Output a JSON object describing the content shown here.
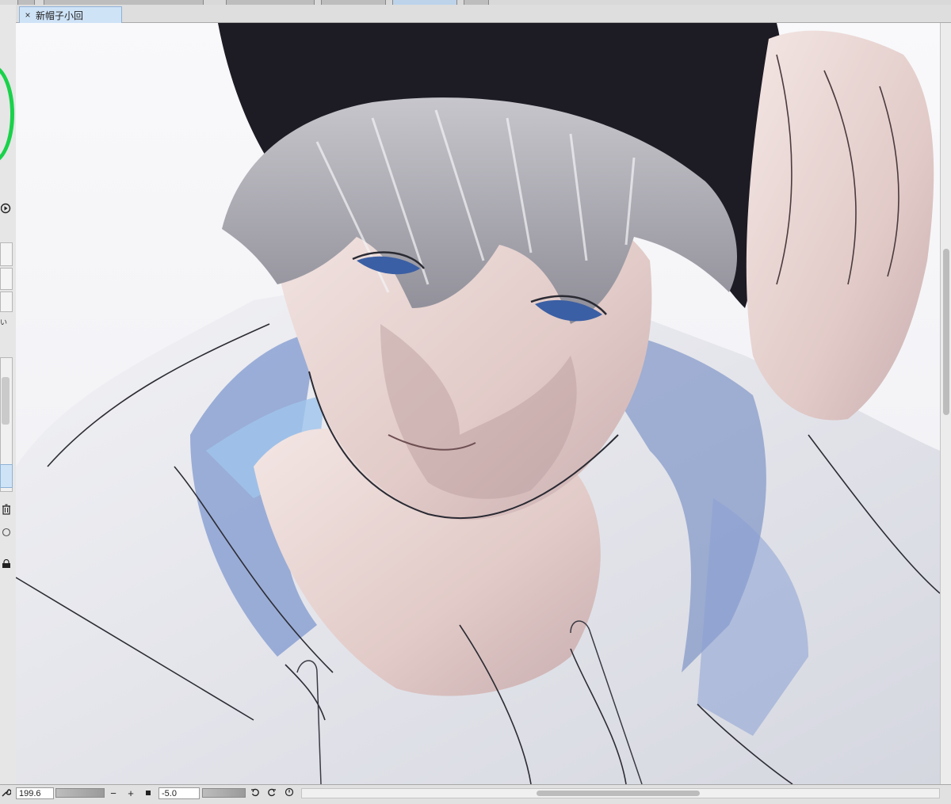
{
  "document": {
    "tab_title": "新帽子小回",
    "close_glyph": "×"
  },
  "status": {
    "zoom_value": "199.6",
    "zoom_out_glyph": "−",
    "zoom_in_glyph": "+",
    "rotation_value": "-5.0"
  },
  "left_panel": {
    "truncated_label": "い"
  },
  "colors": {
    "tab_active": "#cfe3f7",
    "panel_bg": "#e6e6e6",
    "color_wheel_green": "#19d24a"
  },
  "icons": [
    "close-icon",
    "color-wheel",
    "play-icon",
    "trash-icon",
    "rotate-left-icon",
    "rotate-right-icon",
    "reset-rotation-icon",
    "zoom-fit-icon",
    "wrench-icon"
  ]
}
